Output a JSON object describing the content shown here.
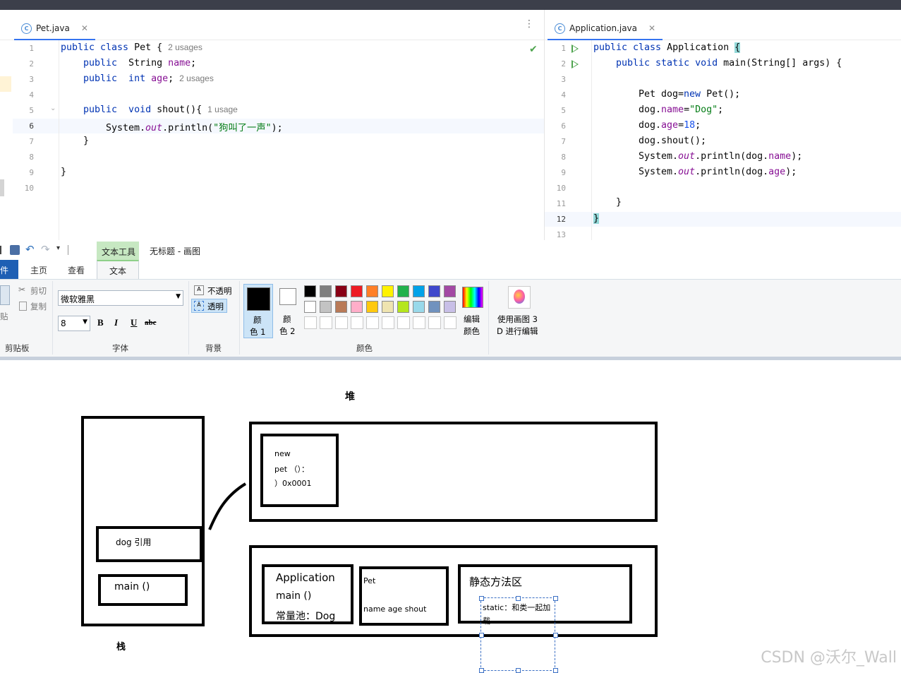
{
  "editor_left": {
    "tab": "Pet.java",
    "line_numbers": [
      "1",
      "2",
      "3",
      "4",
      "5",
      "6",
      "7",
      "8",
      "9",
      "10"
    ],
    "code": {
      "l1_kw": "public class",
      "l1_name": " Pet {",
      "l1_hint": "2 usages",
      "l2_kw": "public",
      "l2_type": "  String ",
      "l2_field": "name",
      "l2_end": ";",
      "l3_kw": "public",
      "l3_type": "  int ",
      "l3_field": "age",
      "l3_end": ";",
      "l3_hint": "2 usages",
      "l5_kw": "public",
      "l5_void": "  void ",
      "l5_method": "shout(){",
      "l5_hint": "1 usage",
      "l6_pre": "System.",
      "l6_out": "out",
      "l6_mid": ".println(",
      "l6_str": "\"狗叫了一声\"",
      "l6_end": ");",
      "l7": "}",
      "l9": "}"
    }
  },
  "editor_right": {
    "tab": "Application.java",
    "line_numbers": [
      "1",
      "2",
      "3",
      "4",
      "5",
      "6",
      "7",
      "8",
      "9",
      "10",
      "11",
      "12",
      "13"
    ],
    "code": {
      "l1_kw": "public class",
      "l1_name": " Application ",
      "l1_brace": "{",
      "l2_kw": "public static void",
      "l2_rest": " main(String[] args) {",
      "l4_a": "Pet dog=",
      "l4_new": "new",
      "l4_b": " Pet();",
      "l5_a": "dog.",
      "l5_f": "name",
      "l5_b": "=",
      "l5_s": "\"Dog\"",
      "l5_c": ";",
      "l6_a": "dog.",
      "l6_f": "age",
      "l6_b": "=",
      "l6_n": "18",
      "l6_c": ";",
      "l7": "dog.shout();",
      "l8_a": "System.",
      "l8_out": "out",
      "l8_b": ".println(dog.",
      "l8_f": "name",
      "l8_c": ");",
      "l9_a": "System.",
      "l9_out": "out",
      "l9_b": ".println(dog.",
      "l9_f": "age",
      "l9_c": ");",
      "l11": "}",
      "l12": "}"
    }
  },
  "paint": {
    "context_tab": "文本工具",
    "title": "无标题 - 画图",
    "tabs": [
      "件",
      "主页",
      "查看",
      "文本"
    ],
    "clipboard": {
      "cut": "剪切",
      "copy": "复制",
      "paste": "贴",
      "group": "剪贴板"
    },
    "font": {
      "name": "微软雅黑",
      "size": "8",
      "bold": "B",
      "italic": "I",
      "underline": "U",
      "strike": "abc",
      "group": "字体"
    },
    "background": {
      "opaque": "不透明",
      "transparent": "透明",
      "group": "背景"
    },
    "colors": {
      "color1_a": "颜",
      "color1_b": "色 1",
      "color2_a": "颜",
      "color2_b": "色 2",
      "edit_a": "编辑",
      "edit_b": "颜色",
      "paint3d_a": "使用画图 3",
      "paint3d_b": "D 进行编辑",
      "group": "颜色",
      "row1": [
        "#000000",
        "#7f7f7f",
        "#880015",
        "#ed1c24",
        "#ff7f27",
        "#fff200",
        "#22b14c",
        "#00a2e8",
        "#3f48cc",
        "#a349a4"
      ],
      "row2": [
        "#ffffff",
        "#c3c3c3",
        "#b97a57",
        "#ffaec9",
        "#ffc90e",
        "#efe4b0",
        "#b5e61d",
        "#99d9ea",
        "#7092be",
        "#c8bfe7"
      ],
      "accent": "#cce4f7"
    }
  },
  "canvas": {
    "heap_label": "堆",
    "stack_label": "栈",
    "dog_ref": "dog 引用",
    "main_stack": "main  ()",
    "heap_obj_1": "new",
    "heap_obj_2": "pet （）：",
    "heap_obj_3": "）0x0001",
    "app_1": "Application",
    "app_2": "main  ()",
    "app_3": "常量池：Dog",
    "pet_1": "Pet",
    "pet_2": "name age shout",
    "static_title": "静态方法区",
    "static_note_1": "static：和类一起加",
    "static_note_2": "载"
  },
  "watermark": "CSDN @沃尔_Wall"
}
